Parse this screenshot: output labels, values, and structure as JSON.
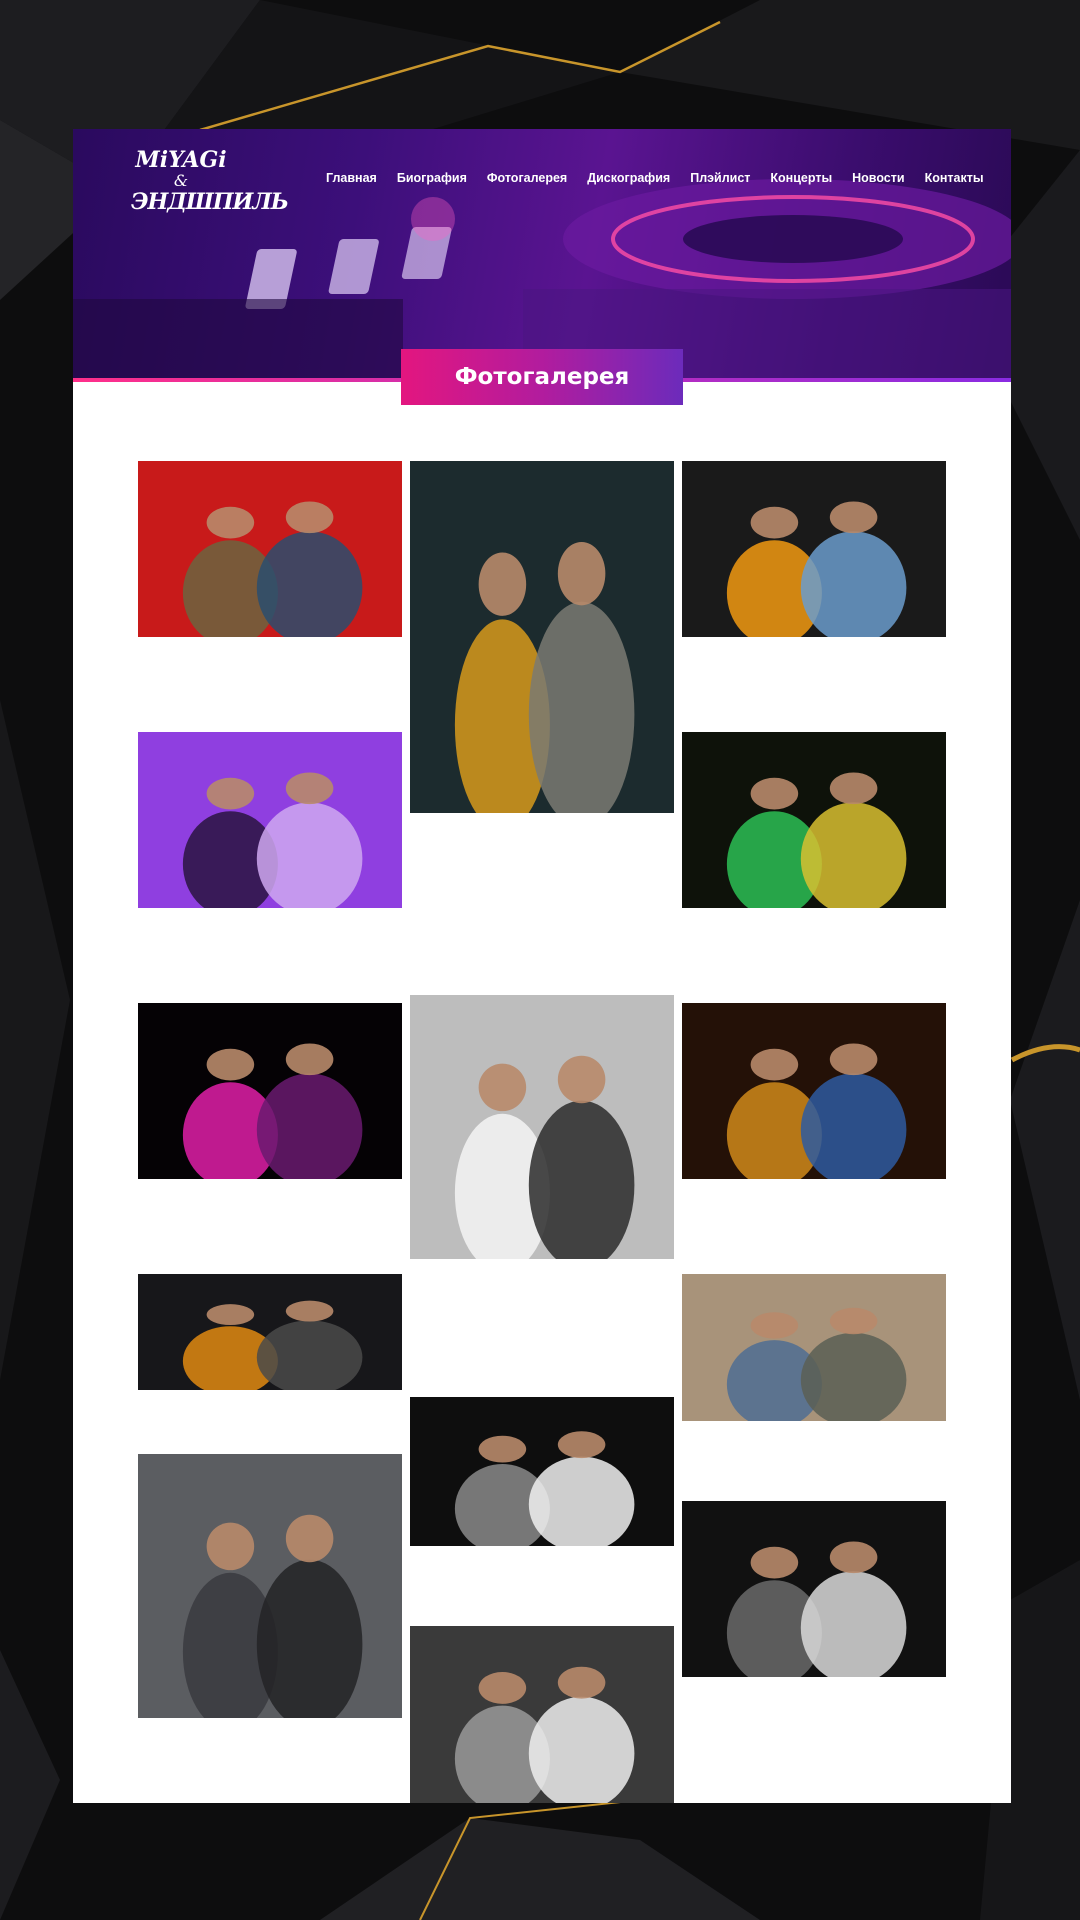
{
  "site": {
    "logo": {
      "line1": "MiYAGi",
      "line2": "&",
      "line3": "ЭНДШПИЛЬ"
    }
  },
  "nav": {
    "items": [
      "Главная",
      "Биография",
      "Фотогалерея",
      "Дискография",
      "Плэйлист",
      "Концерты",
      "Новости",
      "Контакты"
    ]
  },
  "page": {
    "title": "Фотогалерея"
  },
  "gallery": {
    "photos": [
      {
        "name": "photo-duo-red",
        "palette": [
          "#c81a1a",
          "#6b6540",
          "#2a4d6e"
        ]
      },
      {
        "name": "photo-duo-striped-wall",
        "palette": [
          "#1c2b2e",
          "#d79a1b",
          "#7a7a72"
        ]
      },
      {
        "name": "photo-duo-club",
        "palette": [
          "#1a1a1a",
          "#f29a12",
          "#6b9ccc"
        ]
      },
      {
        "name": "photo-stage-purple",
        "palette": [
          "#8f3fe0",
          "#2a1440",
          "#cfa8f0"
        ]
      },
      {
        "name": "photo-stage-green",
        "palette": [
          "#0e120a",
          "#2bbf55",
          "#d8c030"
        ]
      },
      {
        "name": "photo-stage-pink",
        "palette": [
          "#050205",
          "#e01fa8",
          "#6a1a70"
        ]
      },
      {
        "name": "photo-trio-bw",
        "palette": [
          "#bdbdbd",
          "#f4f4f4",
          "#2b2b2b"
        ]
      },
      {
        "name": "photo-stage-warm",
        "palette": [
          "#241107",
          "#d08a1a",
          "#2e5aa0"
        ]
      },
      {
        "name": "photo-poster-duo",
        "palette": [
          "#17171a",
          "#e08a12",
          "#4a4a4a"
        ]
      },
      {
        "name": "photo-duo-street",
        "palette": [
          "#a8937a",
          "#4f6d93",
          "#5a5f55"
        ]
      },
      {
        "name": "photo-duo-stairs",
        "palette": [
          "#5b5d61",
          "#3a3a3f",
          "#232326"
        ]
      },
      {
        "name": "photo-duo-night-bw",
        "palette": [
          "#0e0e0e",
          "#8a8a8a",
          "#f0f0f0"
        ]
      },
      {
        "name": "photo-stage-bw",
        "palette": [
          "#111111",
          "#6a6a6a",
          "#d9d9d9"
        ]
      },
      {
        "name": "photo-mic-bw",
        "palette": [
          "#3a3a3a",
          "#9a9a9a",
          "#ededed"
        ]
      }
    ]
  },
  "scroll_top": {
    "icon": "chevron-up-icon",
    "glyph": "⌃"
  },
  "colors": {
    "accent_pink": "#e3167f",
    "accent_purple": "#6c2bbb",
    "hero_purple": "#3c0f7a"
  }
}
